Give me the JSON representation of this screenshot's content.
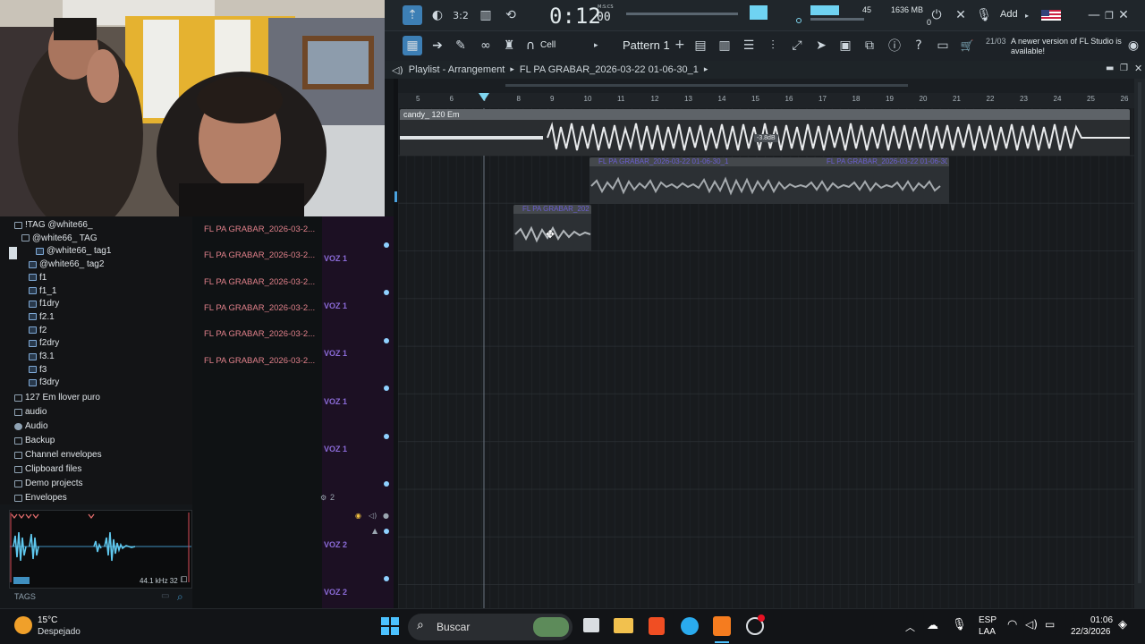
{
  "toolbar": {
    "time": "0:12",
    "time_small": "00",
    "time_unit": "M:S:CS",
    "tempo_value": "45",
    "memory": "1636 MB",
    "memory_sub": "0",
    "add_label": "Add",
    "cell_label": "Cell",
    "pattern_label": "Pattern 1",
    "notice_date": "21/03",
    "notice_text": "A newer version of FL Studio is available!"
  },
  "playlist": {
    "title": "Playlist - Arrangement",
    "breadcrumb": "FL PA GRABAR_2026-03-22 01-06-30_1",
    "ruler": [
      "5",
      "6",
      "7",
      "8",
      "9",
      "10",
      "11",
      "12",
      "13",
      "14",
      "15",
      "16",
      "17",
      "18",
      "19",
      "20",
      "21",
      "22",
      "23",
      "24",
      "25",
      "26"
    ],
    "clip1_label": "candy_ 120 Em",
    "clip2_label": "FL PA GRABAR_2026-03-22 01-06-30_1",
    "clip3_label": "FL PA GRABAR_2026-03-22 01-06-30_1",
    "clip4_label": "FL PA GRABAR_2026-03-2",
    "gain_badge": "-3.8dB"
  },
  "browser": {
    "items": [
      {
        "label": "!TAG @white66_",
        "indent": 0,
        "type": "folder"
      },
      {
        "label": "@white66_ TAG",
        "indent": 1,
        "type": "folder"
      },
      {
        "label": "@white66_ tag1",
        "indent": 3,
        "type": "file"
      },
      {
        "label": "@white66_ tag2",
        "indent": 2,
        "type": "file"
      },
      {
        "label": "f1",
        "indent": 2,
        "type": "file"
      },
      {
        "label": "f1_1",
        "indent": 2,
        "type": "file"
      },
      {
        "label": "f1dry",
        "indent": 2,
        "type": "file"
      },
      {
        "label": "f2.1",
        "indent": 2,
        "type": "file"
      },
      {
        "label": "f2",
        "indent": 2,
        "type": "file"
      },
      {
        "label": "f2dry",
        "indent": 2,
        "type": "file"
      },
      {
        "label": "f3.1",
        "indent": 2,
        "type": "file"
      },
      {
        "label": "f3",
        "indent": 2,
        "type": "file"
      },
      {
        "label": "f3dry",
        "indent": 2,
        "type": "file"
      },
      {
        "label": "127 Em llover puro",
        "indent": 0,
        "type": "folder"
      },
      {
        "label": "audio",
        "indent": 0,
        "type": "folder"
      },
      {
        "label": "Audio",
        "indent": 0,
        "type": "user"
      },
      {
        "label": "Backup",
        "indent": 0,
        "type": "folder"
      },
      {
        "label": "Channel envelopes",
        "indent": 0,
        "type": "folder"
      },
      {
        "label": "Clipboard files",
        "indent": 0,
        "type": "folder"
      },
      {
        "label": "Demo projects",
        "indent": 0,
        "type": "folder"
      },
      {
        "label": "Envelopes",
        "indent": 0,
        "type": "folder"
      }
    ],
    "sample_rate": "44.1 kHz 32",
    "tags_label": "TAGS"
  },
  "picker": {
    "items": [
      "FL PA GRABAR_2026-03-2...",
      "FL PA GRABAR_2026-03-2...",
      "FL PA GRABAR_2026-03-2...",
      "FL PA GRABAR_2026-03-2...",
      "FL PA GRABAR_2026-03-2...",
      "FL PA GRABAR_2026-03-2..."
    ]
  },
  "tracks": {
    "labels": [
      "VOZ 1",
      "VOZ 1",
      "VOZ 1",
      "VOZ 1",
      "VOZ 1",
      "VOZ 2",
      "VOZ 2"
    ],
    "group_number": "2"
  },
  "taskbar": {
    "weather_temp": "15°C",
    "weather_desc": "Despejado",
    "search_label": "Buscar",
    "lang_top": "ESP",
    "lang_bottom": "LAA",
    "clock_time": "01:06",
    "clock_date": "22/3/2026"
  },
  "colors": {
    "accent": "#7fd6f0",
    "clip_bg": "#5f6469",
    "track_label": "#8b6bd8",
    "picker_text": "#e0808a",
    "gain_badge": "#4a4f54"
  }
}
